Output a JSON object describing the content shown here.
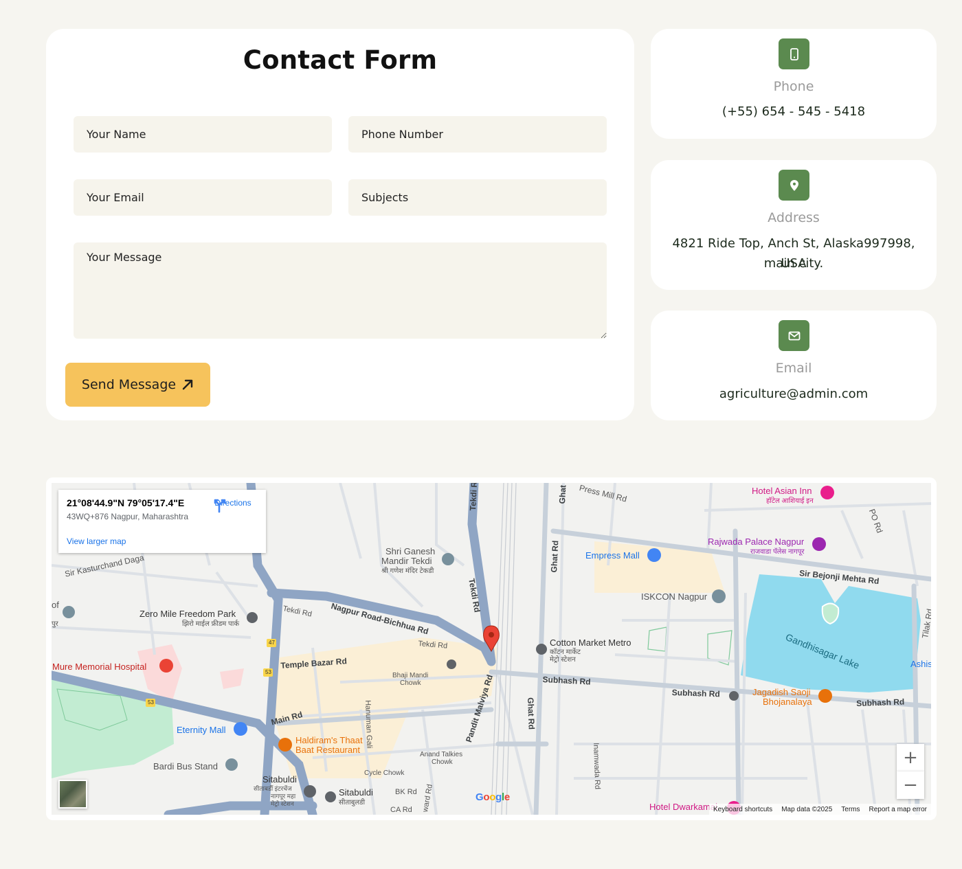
{
  "form": {
    "title": "Contact Form",
    "name_placeholder": "Your Name",
    "phone_placeholder": "Phone Number",
    "email_placeholder": "Your Email",
    "subject_placeholder": "Subjects",
    "message_placeholder": "Your Message",
    "send_label": "Send Message"
  },
  "contact": {
    "phone": {
      "label": "Phone",
      "value": "(+55) 654 - 545 - 5418",
      "icon": "phone-icon"
    },
    "address": {
      "label": "Address",
      "line1": "4821 Ride Top, Anch St, Alaska997998, USA",
      "line2": "main city.",
      "icon": "map-pin-icon"
    },
    "email": {
      "label": "Email",
      "value": "agriculture@admin.com",
      "icon": "envelope-icon"
    }
  },
  "colors": {
    "accent_green": "#5b8a4f",
    "button_yellow": "#f6c35c",
    "field_bg": "#f6f4ec",
    "page_bg": "#f6f5f0"
  },
  "map": {
    "coords": "21°08'44.9\"N 79°05'17.4\"E",
    "address": "43WQ+876 Nagpur, Maharashtra",
    "directions": "Directions",
    "view_larger": "View larger map",
    "zoom_in": "+",
    "zoom_out": "−",
    "logo": "Google",
    "attribution": {
      "shortcuts": "Keyboard shortcuts",
      "data": "Map data ©2025",
      "terms": "Terms",
      "report": "Report a map error"
    },
    "labels": {
      "tekdi_rd_v": "Tekdi Rd",
      "tekdi_rd_v2": "Tekdi Rd",
      "nagpur_bichhua": "Nagpur Road-Bichhua Rd",
      "tekdi_rd_h": "Tekdi Rd",
      "tekdi_rd_h2": "Tekdi Rd",
      "temple_bazar": "Temple Bazar Rd",
      "main_rd": "Main Rd",
      "subhash_rd1": "Subhash Rd",
      "subhash_rd2": "Subhash Rd",
      "subhash_rd3": "Subhash Rd",
      "ghat_rd1": "Ghat Rd",
      "ghat_rd2": "Ghat Rd",
      "ghat_rd_top": "Ghat",
      "pandit": "Pandit Malviya Rd",
      "hanuman": "Hanuman Gali",
      "inamwada": "Inamwada Rd",
      "sir_bejonji": "Sir Bejonji Mehta Rd",
      "sir_kasturchand": "Sir Kasturchand Daga",
      "press_mill": "Press Mill Rd",
      "po_rd": "PO Rd",
      "tilak_rd": "Tilak Rd",
      "bk_rd": "BK Rd",
      "ca_rd": "CA Rd",
      "ward_rd": "ward Rd",
      "shri_ganesh": "Shri Ganesh",
      "mandir_tekdi": "Mandir Tekdi",
      "shri_ganesh_hi": "श्री गणेश मंदिर टेकडी",
      "zero_mile": "Zero Mile Freedom Park",
      "zero_mile_hi": "झिरो माईल फ्रीडम पार्क",
      "mure": "Mure Memorial Hospital",
      "eternity": "Eternity Mall",
      "haldiram1": "Haldiram's Thaat",
      "haldiram2": "Baat Restaurant",
      "bardi": "Bardi Bus Stand",
      "sitabuldi1": "Sitabuldi",
      "sitabuldi1_hi": "सीताबर्डी इंटरचेंज",
      "sitabuldi1_hi2": "नागपूर महा",
      "sitabuldi1_hi3": "मेट्रो स्टेशन",
      "sitabuldi2": "Sitabuldi",
      "sitabuldi2_hi": "सीताबुलडी",
      "bhaji_mandi": "Bhaji Mandi",
      "bhaji_chowk": "Chowk",
      "anand1": "Anand Talkies",
      "anand2": "Chowk",
      "cycle_chowk": "Cycle Chowk",
      "cotton": "Cotton Market Metro",
      "cotton_hi": "कॉटन मार्केट",
      "cotton_hi2": "मेट्रो स्टेशन",
      "empress": "Empress Mall",
      "iskcon": "ISKCON Nagpur",
      "rajwada": "Rajwada Palace Nagpur",
      "rajwada_hi": "राजवाडा पॅलेस नागपूर",
      "hotel_asian": "Hotel Asian Inn",
      "hotel_asian_hi": "हॉटेल आशियाई इन",
      "gandhisagar": "Gandhisagar Lake",
      "jagdish1": "Jagadish Saoji",
      "jagdish2": "Bhojanalaya",
      "hotel_dwarkamai": "Hotel Dwarkamai",
      "ashis": "Ashis",
      "of": "of",
      "pur": "पुर",
      "shield_47": "47",
      "shield_53a": "53",
      "shield_53b": "53"
    }
  }
}
